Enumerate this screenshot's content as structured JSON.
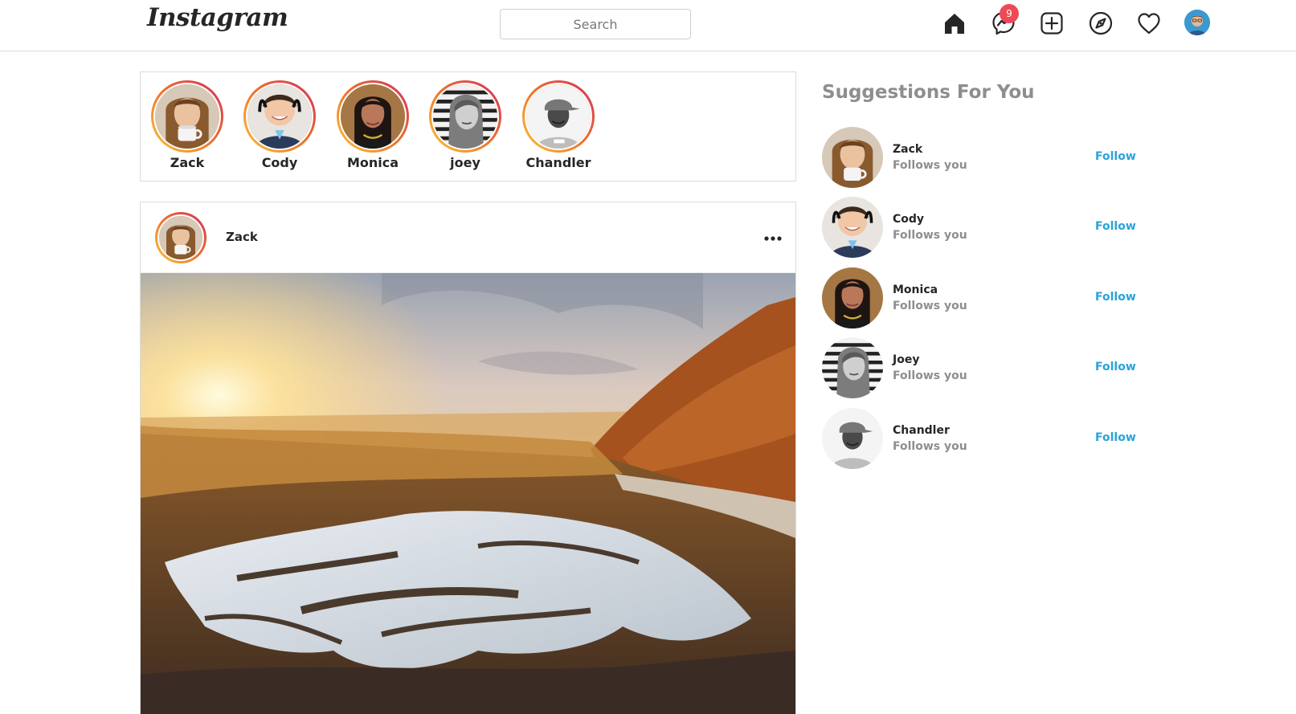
{
  "header": {
    "logo_text": "Instagram",
    "search_placeholder": "Search",
    "messages_badge": "9",
    "icons": [
      "home-icon",
      "messenger-icon",
      "new-post-icon",
      "explore-icon",
      "activity-heart-icon",
      "profile-avatar"
    ]
  },
  "stories": [
    {
      "name": "Zack"
    },
    {
      "name": "Cody"
    },
    {
      "name": "Monica"
    },
    {
      "name": "joey"
    },
    {
      "name": "Chandler"
    }
  ],
  "post": {
    "username": "Zack",
    "more_icon": "more-options-icon",
    "image_subject": "sunset-landscape-photo"
  },
  "suggestions": {
    "title": "Suggestions For You",
    "items": [
      {
        "name": "Zack",
        "subtitle": "Follows you",
        "action": "Follow"
      },
      {
        "name": "Cody",
        "subtitle": "Follows you",
        "action": "Follow"
      },
      {
        "name": "Monica",
        "subtitle": "Follows you",
        "action": "Follow"
      },
      {
        "name": "Joey",
        "subtitle": "Follows you",
        "action": "Follow"
      },
      {
        "name": "Chandler",
        "subtitle": "Follows you",
        "action": "Follow"
      }
    ]
  },
  "colors": {
    "accent_follow": "#2aa3d8",
    "badge": "#ed4956",
    "story_ring_start": "#f9c43a",
    "story_ring_end": "#d12e5a",
    "border": "#dbdbdb"
  }
}
